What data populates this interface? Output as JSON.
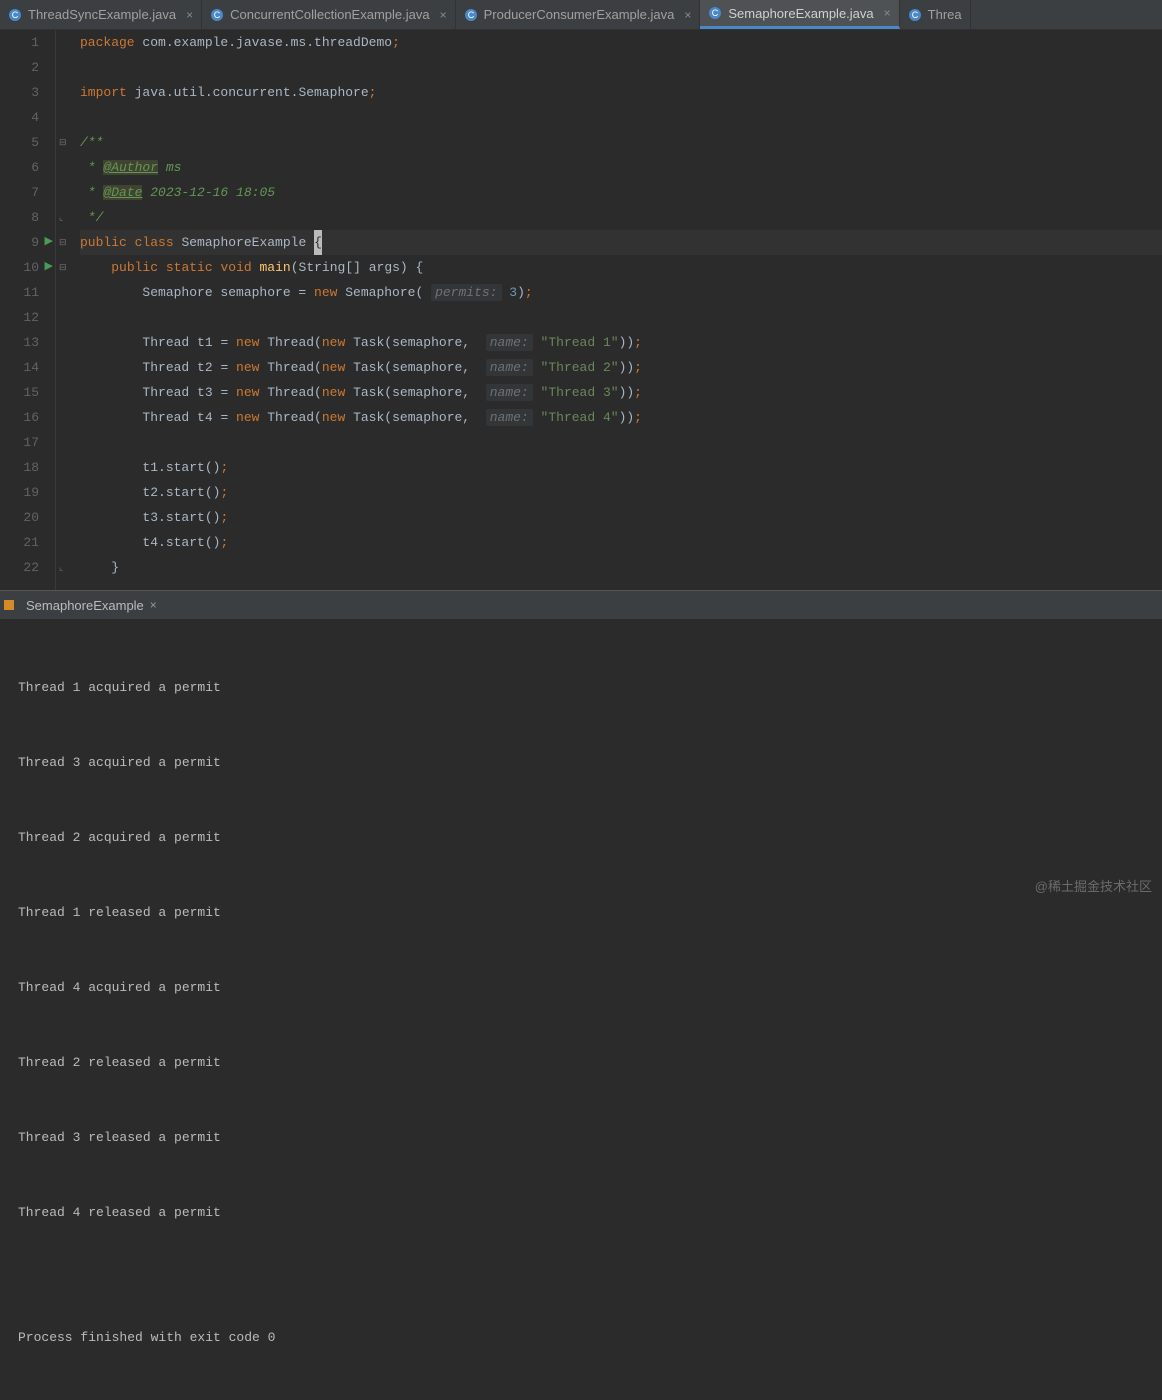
{
  "tabs": [
    {
      "label": "ThreadSyncExample.java",
      "active": false
    },
    {
      "label": "ConcurrentCollectionExample.java",
      "active": false
    },
    {
      "label": "ProducerConsumerExample.java",
      "active": false
    },
    {
      "label": "SemaphoreExample.java",
      "active": true
    },
    {
      "label": "Threa",
      "active": false,
      "partial": true
    }
  ],
  "code": {
    "package_kw": "package",
    "package_name": " com.example.javase.ms.threadDemo",
    "import_kw": "import",
    "import_name": " java.util.concurrent.Semaphore",
    "doc_open": "/**",
    "doc_author_prefix": " * ",
    "doc_author_tag": "@Author",
    "doc_author_val": " ms",
    "doc_date_prefix": " * ",
    "doc_date_tag": "@Date",
    "doc_date_val": " 2023-12-16 18:05",
    "doc_close": " */",
    "public": "public",
    "class": "class",
    "static": "static",
    "void": "void",
    "new": "new",
    "cls_name": " SemaphoreExample ",
    "main_name": "main",
    "main_params": "(String[] args) {",
    "sem_line_a": "        Semaphore semaphore = ",
    "sem_line_b": " Semaphore( ",
    "hint_permits": "permits:",
    "sem_num": " 3",
    "sem_line_c": ")",
    "thread_prefix": "        Thread ",
    "thread_vars": [
      "t1",
      "t2",
      "t3",
      "t4"
    ],
    "thread_mid_a": " = ",
    "thread_mid_b": " Thread(",
    "thread_mid_c": " Task(semaphore,  ",
    "hint_name": "name:",
    "thread_strings": [
      "\"Thread 1\"",
      "\"Thread 2\"",
      "\"Thread 3\"",
      "\"Thread 4\""
    ],
    "thread_end": "))",
    "start_calls": [
      "        t1.start()",
      "        t2.start()",
      "        t3.start()",
      "        t4.start()"
    ],
    "close_brace": "    }"
  },
  "line_numbers": [
    "1",
    "2",
    "3",
    "4",
    "5",
    "6",
    "7",
    "8",
    "9",
    "10",
    "11",
    "12",
    "13",
    "14",
    "15",
    "16",
    "17",
    "18",
    "19",
    "20",
    "21",
    "22"
  ],
  "console": {
    "run_tab": "SemaphoreExample",
    "lines": [
      "Thread 1 acquired a permit",
      "Thread 3 acquired a permit",
      "Thread 2 acquired a permit",
      "Thread 1 released a permit",
      "Thread 4 acquired a permit",
      "Thread 2 released a permit",
      "Thread 3 released a permit",
      "Thread 4 released a permit",
      "",
      "Process finished with exit code 0"
    ]
  },
  "watermark": "@稀土掘金技术社区"
}
